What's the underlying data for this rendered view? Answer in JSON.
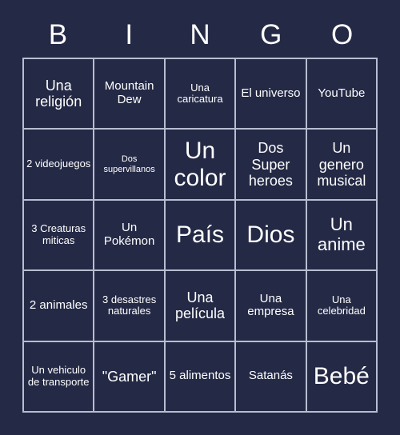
{
  "card": {
    "header_letters": [
      "B",
      "I",
      "N",
      "G",
      "O"
    ],
    "colors": {
      "background": "#242945",
      "grid_line": "#b9bdd1",
      "text": "#ffffff"
    },
    "rows": [
      [
        {
          "text": "Una religión",
          "size": "l"
        },
        {
          "text": "Mountain Dew",
          "size": "m"
        },
        {
          "text": "Una caricatura",
          "size": "s"
        },
        {
          "text": "El universo",
          "size": "m"
        },
        {
          "text": "YouTube",
          "size": "m"
        }
      ],
      [
        {
          "text": "2 videojuegos",
          "size": "s"
        },
        {
          "text": "Dos supervillanos",
          "size": "xs"
        },
        {
          "text": "Un color",
          "size": "xxl"
        },
        {
          "text": "Dos Super heroes",
          "size": "l"
        },
        {
          "text": "Un genero musical",
          "size": "l"
        }
      ],
      [
        {
          "text": "3 Creaturas miticas",
          "size": "s"
        },
        {
          "text": "Un Pokémon",
          "size": "m"
        },
        {
          "text": "País",
          "size": "xxl"
        },
        {
          "text": "Dios",
          "size": "xxl"
        },
        {
          "text": "Un anime",
          "size": "xl"
        }
      ],
      [
        {
          "text": "2 animales",
          "size": "m"
        },
        {
          "text": "3 desastres naturales",
          "size": "s"
        },
        {
          "text": "Una película",
          "size": "l"
        },
        {
          "text": "Una empresa",
          "size": "m"
        },
        {
          "text": "Una celebridad",
          "size": "s"
        }
      ],
      [
        {
          "text": "Un vehiculo de transporte",
          "size": "s"
        },
        {
          "text": "\"Gamer\"",
          "size": "l"
        },
        {
          "text": "5 alimentos",
          "size": "m"
        },
        {
          "text": "Satanás",
          "size": "m"
        },
        {
          "text": "Bebé",
          "size": "xxl"
        }
      ]
    ]
  }
}
